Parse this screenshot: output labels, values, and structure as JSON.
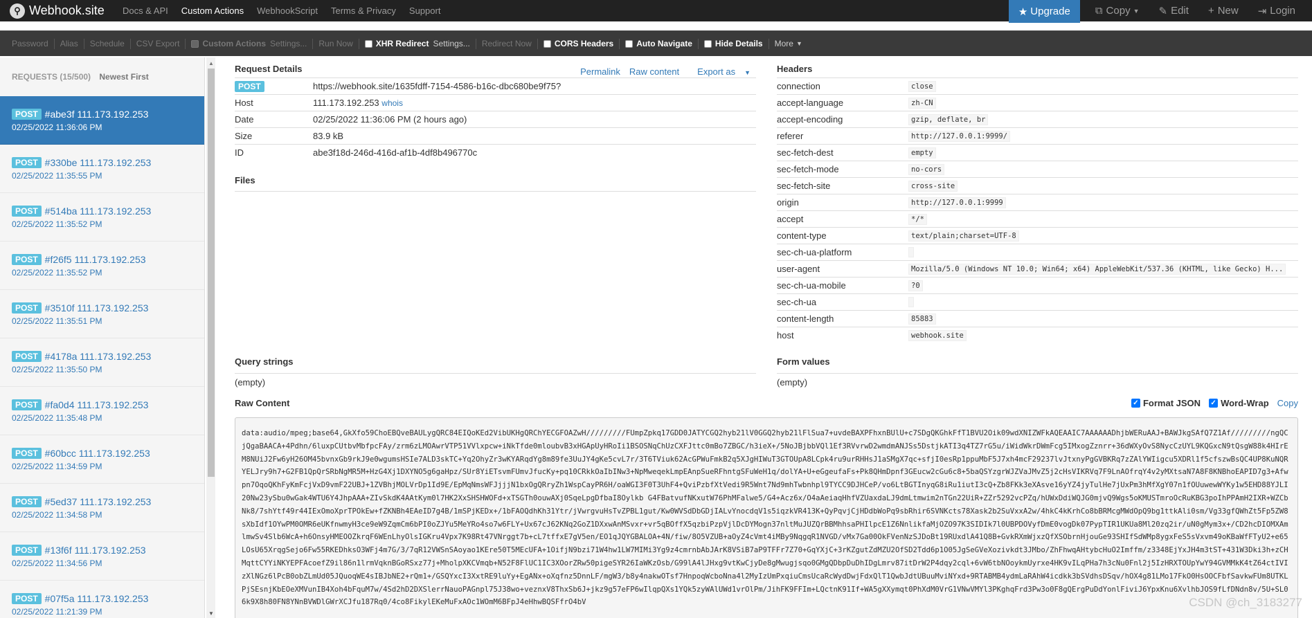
{
  "navbar": {
    "brand": "Webhook.site",
    "links": [
      "Docs & API",
      "Custom Actions",
      "WebhookScript",
      "Terms & Privacy",
      "Support"
    ],
    "active_link": "Custom Actions",
    "upgrade": "Upgrade",
    "copy": "Copy",
    "edit": "Edit",
    "new": "New",
    "login": "Login"
  },
  "toolbar": {
    "password": "Password",
    "alias": "Alias",
    "schedule": "Schedule",
    "csv_export": "CSV Export",
    "custom_actions": "Custom Actions",
    "custom_actions_settings": "Settings...",
    "run_now": "Run Now",
    "xhr_redirect": "XHR Redirect",
    "xhr_settings": "Settings...",
    "redirect_now": "Redirect Now",
    "cors_headers": "CORS Headers",
    "auto_navigate": "Auto Navigate",
    "hide_details": "Hide Details",
    "more": "More"
  },
  "sidebar": {
    "requests_count": "REQUESTS (15/500)",
    "sort": "Newest First",
    "items": [
      {
        "method": "POST",
        "title": "#abe3f 111.173.192.253",
        "time": "02/25/2022 11:36:06 PM",
        "active": true
      },
      {
        "method": "POST",
        "title": "#330be 111.173.192.253",
        "time": "02/25/2022 11:35:55 PM"
      },
      {
        "method": "POST",
        "title": "#514ba 111.173.192.253",
        "time": "02/25/2022 11:35:52 PM"
      },
      {
        "method": "POST",
        "title": "#f26f5 111.173.192.253",
        "time": "02/25/2022 11:35:52 PM"
      },
      {
        "method": "POST",
        "title": "#3510f 111.173.192.253",
        "time": "02/25/2022 11:35:51 PM"
      },
      {
        "method": "POST",
        "title": "#4178a 111.173.192.253",
        "time": "02/25/2022 11:35:50 PM"
      },
      {
        "method": "POST",
        "title": "#fa0d4 111.173.192.253",
        "time": "02/25/2022 11:35:48 PM"
      },
      {
        "method": "POST",
        "title": "#60bcc 111.173.192.253",
        "time": "02/25/2022 11:34:59 PM"
      },
      {
        "method": "POST",
        "title": "#5ed37 111.173.192.253",
        "time": "02/25/2022 11:34:58 PM"
      },
      {
        "method": "POST",
        "title": "#13f6f 111.173.192.253",
        "time": "02/25/2022 11:34:56 PM"
      },
      {
        "method": "POST",
        "title": "#07f5a 111.173.192.253",
        "time": "02/25/2022 11:21:39 PM"
      }
    ]
  },
  "request_details": {
    "title": "Request Details",
    "permalink": "Permalink",
    "raw_content": "Raw content",
    "export_as": "Export as",
    "method": "POST",
    "url": "https://webhook.site/1635fdff-7154-4586-b16c-dbc680be9f75?",
    "host_label": "Host",
    "host": "111.173.192.253",
    "whois": "whois",
    "date_label": "Date",
    "date": "02/25/2022 11:36:06 PM (2 hours ago)",
    "size_label": "Size",
    "size": "83.9 kB",
    "id_label": "ID",
    "id": "abe3f18d-246d-416d-af1b-4df8b496770c"
  },
  "files": {
    "title": "Files"
  },
  "headers": {
    "title": "Headers",
    "rows": [
      {
        "key": "connection",
        "value": "close"
      },
      {
        "key": "accept-language",
        "value": "zh-CN"
      },
      {
        "key": "accept-encoding",
        "value": "gzip, deflate, br"
      },
      {
        "key": "referer",
        "value": "http://127.0.0.1:9999/"
      },
      {
        "key": "sec-fetch-dest",
        "value": "empty"
      },
      {
        "key": "sec-fetch-mode",
        "value": "no-cors"
      },
      {
        "key": "sec-fetch-site",
        "value": "cross-site"
      },
      {
        "key": "origin",
        "value": "http://127.0.0.1:9999"
      },
      {
        "key": "accept",
        "value": "*/*"
      },
      {
        "key": "content-type",
        "value": "text/plain;charset=UTF-8"
      },
      {
        "key": "sec-ch-ua-platform",
        "value": ""
      },
      {
        "key": "user-agent",
        "value": "Mozilla/5.0 (Windows NT 10.0; Win64; x64) AppleWebKit/537.36 (KHTML, like Gecko) H..."
      },
      {
        "key": "sec-ch-ua-mobile",
        "value": "?0"
      },
      {
        "key": "sec-ch-ua",
        "value": ""
      },
      {
        "key": "content-length",
        "value": "85883"
      },
      {
        "key": "host",
        "value": "webhook.site"
      }
    ]
  },
  "query_strings": {
    "title": "Query strings",
    "value": "(empty)"
  },
  "form_values": {
    "title": "Form values",
    "value": "(empty)"
  },
  "raw": {
    "title": "Raw Content",
    "format_json": "Format JSON",
    "word_wrap": "Word-Wrap",
    "copy": "Copy",
    "content": "data:audio/mpeg;base64,GkXfo59ChoEBQveBAULygQRC84EIQoKEd2VibUKHgQRChYECGFOAZwH/////////FUmpZpkq17GDD0JATYCGQ2hyb21lV0GGQ2hyb21lFlSua7+uvdeBAXPFhxnBUlU+c7SDgQKGhkFfT1BVU2Oik09wdXNIZWFkAQEAAIC7AAAAAADhjbWERuAAJ+BAWJkgSAfQ7Z1Af/////////ngQCjQgaBAACA+4Pdhn/6luxpCUtbvMbfpcFAy/zrm6zLMOAwrVTP51VVlxpcw+iNkTfde0mloubvB3xHGApUyHRoIi1BSOSNqChUzCXFJttc0mBo7ZBGC/h3ieX+/5NoJBjbbVQl1Ef3RVvrwD2wmdmANJSs5DstjkATI3q4TZ7rG5u/iWidWkrDWmFcg5IMxogZznrr+36dWXyOvS8NycCzUYL9KQGxcN9tQsgW88k4HIrEM8NUiJ2Fw6yH26OM45bvnxGb9rkJ9e0wgumsHSIe7ALD3skTC+Yq2OhyZr3wKYARqdYg8m89fe3UuJY4gKe5cvL7r/3T6TViuk62AcGPWuFmkB2q5XJgHIWuT3GTOUpA8LCpk4ru9urRHHsJ1aSMgX7qc+sfjI0esRp1ppuMbF5J7xh4mcF29237lvJtxnyPgGVBKRq7zZAlYWIigcu5XDRl1f5cfszwBsQC4UP8KuNQRYELJry9h7+G2FB1QpQrSRbNgMR5M+HzG4Xj1DXYNO5g6gaHpz/SUr8YiETsvmFUmvJfucKy+pq10CRkkOaIbINw3+NpMweqekLmpEAnpSueRFhntgSFuWeH1q/dolYA+U+eGgeufaFs+Pk8QHmDpnf3GEucw2cGu6c8+5baQSYzgrWJZVaJMvZ5j2cHsVIKRVq7F9LnAOfrqY4v2yMXtsaN7A8F8KNBhoEAPID7g3+Afwpn7OqoQKhFyKmFcjVxD9vmF22UBJ+1ZVBhjMOLVrDp1Id9E/EpMqNmsWFJjjjN1bxOgQRryZh1WspCayPR6H/oaWGI3F0T3UhF4+QviPzbfXtVedi9R5Wnt7Nd9mhTwbnhpl9TYCC9DJHCeP/vo6LtBGTInyqG8iRu1iutI3cQ+Zb8FKk3eXAsve16yYZ4jyTulHe7jUxPm3hMfXgY07n1fOUuwewWYKy1w5EHD88YJLI20Nw23ySbu0wGak4WTU6Y4JhpAAA+ZIvSkdK4AAtKym0l7HK2XxSHSHWOFd+xTSGTh0ouwAXj0SqeLpgDfbaI8Oylkb G4FBatvufNKxutW76PhMFalwe5/G4+Acz6x/O4aAeiaqHhfVZUaxdaLJ9dmLtmwim2nTGn22UiR+ZZr5292vcPZq/hUWxDdiWQJG0mjvQ9Wgs5oKMUSTmroOcRuKBG3poIhPPAmH2IXR+WZCbNk8/7shYtf49r44IExOmoXprTPOkEw+fZKNBh4EAeID7g4B/1mSPjKEDx+/1bFAOQdhKh31Ytr/jVwrgvuHsTvZPBL1gut/Kw0WVSdDbGDjIALvYnocdqV1s5iqzkVR413K+QyPqvjCjHDdbWoPq9sbRhir6SVNKcts78Xask2b2SuVxxA2w/4hkC4kKrhCo8bBRMcgMWdOpQ9bg1ttkAli0sm/Vg33gfQWhZt5Fp5ZW8sXbIdf1OYwPM0OMR6eUKfnwmyH3ce9eW9ZqmCm6bPI0oZJYu5MeYRo4so7w6FLY+Ux67cJ62KNq2GoZ1DXxwAnMSvxr+vr5qBOffX5qzbiPzpVjlDcDYMogn37nltMuJUZQrBBMhhsaPHIlpcE1Z6NnlikfaMjOZO97K3SIDIk7l0UBPDOVyfDmE0vogDk07PypTIR1UKUa8Ml20zq2ir/uN0gMym3x+/CD2hcDIOMXAmlmwSv4Slb6WcA+h6OnsyHMEOOZkrqF6WEnLhyOlsIGKru4Vpx7K98Rt47VNrggt7b+cL7tffxE7gV5en/EO1qJQYGBALOA+4N/fiw/8O5VZUB+aOyZ4cVmt4iMBy9NqgqR1NVGD/vMx7Ga00OkFVenNzSJDoBt19RUxdlA41Q8B+GvkRXmWjxzQfXSObrnHjouGe93SHIfSdWMp8ygxFeS5sVxvm49oKBaWfFTyU2+e65LOsU65XrqgSejo6Fw55RKEDhksO3WFj4m7G/3/7qR12VWSnSAoyao1KEre50T5MEcUFA+1OifjN9bzi71W4hw1LW7MIMi3Yg9z4cmrnbAbJArK8VSiB7aP9TFFr7Z70+GqYXjC+3rKZgutZdMZU2OfSD2Tdd6p1O05JgSeGVeXozivkdt3JMbo/ZhFhwqAHtybcHuO2Imffm/z3348EjYxJH4m3tST+431W3Dki3h+zCHMqttCYYiNKYEPFAcoefZ9il86n1lrmVqknBGoRSxz77j+MholpXKCVmqb+N52F8FlUC1IC3XOorZRw50pigeSYR26IaWKzOsb/G99lA4lJHxg9vtKwCjyDe8gMwugjsqo0GMgQDbpDuDhIDgLmrv87itDrW2P4dqy2cql+6vW6tbNOoykmUyrxe4HK9vILqPHa7h3cNu0Fnl2j5IzHRXTOUpYwY94GVMMkK4tZ64ctIVIzXlNGz6lPcB0obZLmUd05JQuoqWE4sIBJbNE2+rQm1+/GSQYxcI3XxtRE9luYy+EgANx+oXqfnz5DnnLF/mgW3/b8y4nakwOTsf7HnpoqWcboNna4l2MyIzUmPxqiuCmsUcaRcWydDwjFdxQlT1QwbJdtUBuuMviNYxd+9RTABMB4ydmLaRAhW4icdkk3bSVdhsDSqv/hOX4g81LMo17FkO0HsOOCFbfSavkwFUm8UTKLPjSEsnjKbEOeXMVunIB4Xoh4bFquM7w/4Sd2hD2DXSlerrNauoPAGnpl75J38wo+veznxV8ThxSb6J+jkz9g57eFP6wIlqpQXs1YQk5zyWAlUWd1vrOlPm/JihFK9FFIm+LQctnK91If+WA5gXXymqt0PhXdM0VrG1VNwVMYl3PKghqFrd3Pw3o0F8gQErgPuDdYonlFiviJ6YpxKnu6XvlhbJOS9fLfDNdn8v/5U+SL06k9X8h80FN8YNnBVWDlGWrXCJfu187Rq0/4co8FikylEKeMuFxAOc1WOmM6BFpJ4eHhwBQSFfrO4bV"
  },
  "watermark": "CSDN @ch_3183277"
}
